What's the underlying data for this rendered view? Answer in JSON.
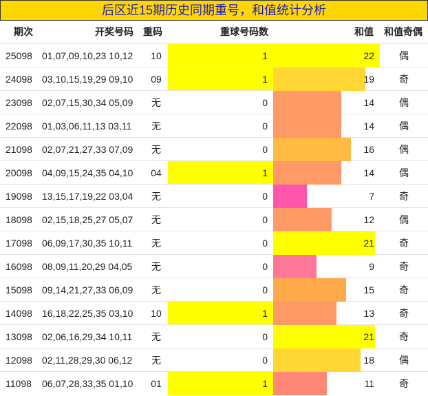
{
  "title": "后区近15期历史同期重号，和值统计分析",
  "headers": {
    "issue": "期次",
    "numbers": "开奖号码",
    "repeat": "重码",
    "repeat_count": "重球号码数",
    "sum": "和值",
    "parity": "和值奇偶"
  },
  "colors": {
    "title_bg": "#ffd700",
    "title_text": "#1a1ac8",
    "highlight": "#ffff00",
    "sum_21_22": "#ffff00",
    "sum_18_19": "#ffd633",
    "sum_16": "#ffbb44",
    "sum_15": "#ffaa4a",
    "sum_12_14": "#ff9966",
    "sum_11": "#ff8877",
    "sum_9": "#ff7799",
    "sum_7": "#ff55aa"
  },
  "rows": [
    {
      "issue": "25098",
      "numbers": "01,07,09,10,23 10,12",
      "repeat": "10",
      "count": "1",
      "sum": "22",
      "parity": "偶"
    },
    {
      "issue": "24098",
      "numbers": "03,10,15,19,29 09,10",
      "repeat": "09",
      "count": "1",
      "sum": "19",
      "parity": "奇"
    },
    {
      "issue": "23098",
      "numbers": "02,07,15,30,34 05,09",
      "repeat": "无",
      "count": "0",
      "sum": "14",
      "parity": "偶"
    },
    {
      "issue": "22098",
      "numbers": "01,03,06,11,13 03,11",
      "repeat": "无",
      "count": "0",
      "sum": "14",
      "parity": "偶"
    },
    {
      "issue": "21098",
      "numbers": "02,07,21,27,33 07,09",
      "repeat": "无",
      "count": "0",
      "sum": "16",
      "parity": "偶"
    },
    {
      "issue": "20098",
      "numbers": "04,09,15,24,35 04,10",
      "repeat": "04",
      "count": "1",
      "sum": "14",
      "parity": "偶"
    },
    {
      "issue": "19098",
      "numbers": "13,15,17,19,22 03,04",
      "repeat": "无",
      "count": "0",
      "sum": "7",
      "parity": "奇"
    },
    {
      "issue": "18098",
      "numbers": "02,15,18,25,27 05,07",
      "repeat": "无",
      "count": "0",
      "sum": "12",
      "parity": "偶"
    },
    {
      "issue": "17098",
      "numbers": "06,09,17,30,35 10,11",
      "repeat": "无",
      "count": "0",
      "sum": "21",
      "parity": "奇"
    },
    {
      "issue": "16098",
      "numbers": "08,09,11,20,29 04,05",
      "repeat": "无",
      "count": "0",
      "sum": "9",
      "parity": "奇"
    },
    {
      "issue": "15098",
      "numbers": "09,14,21,27,33 06,09",
      "repeat": "无",
      "count": "0",
      "sum": "15",
      "parity": "奇"
    },
    {
      "issue": "14098",
      "numbers": "16,18,22,25,35 03,10",
      "repeat": "10",
      "count": "1",
      "sum": "13",
      "parity": "奇"
    },
    {
      "issue": "13098",
      "numbers": "02,06,16,29,34 10,11",
      "repeat": "无",
      "count": "0",
      "sum": "21",
      "parity": "奇"
    },
    {
      "issue": "12098",
      "numbers": "02,11,28,29,30 06,12",
      "repeat": "无",
      "count": "0",
      "sum": "18",
      "parity": "偶"
    },
    {
      "issue": "11098",
      "numbers": "06,07,28,33,35 01,10",
      "repeat": "01",
      "count": "1",
      "sum": "11",
      "parity": "奇"
    }
  ]
}
